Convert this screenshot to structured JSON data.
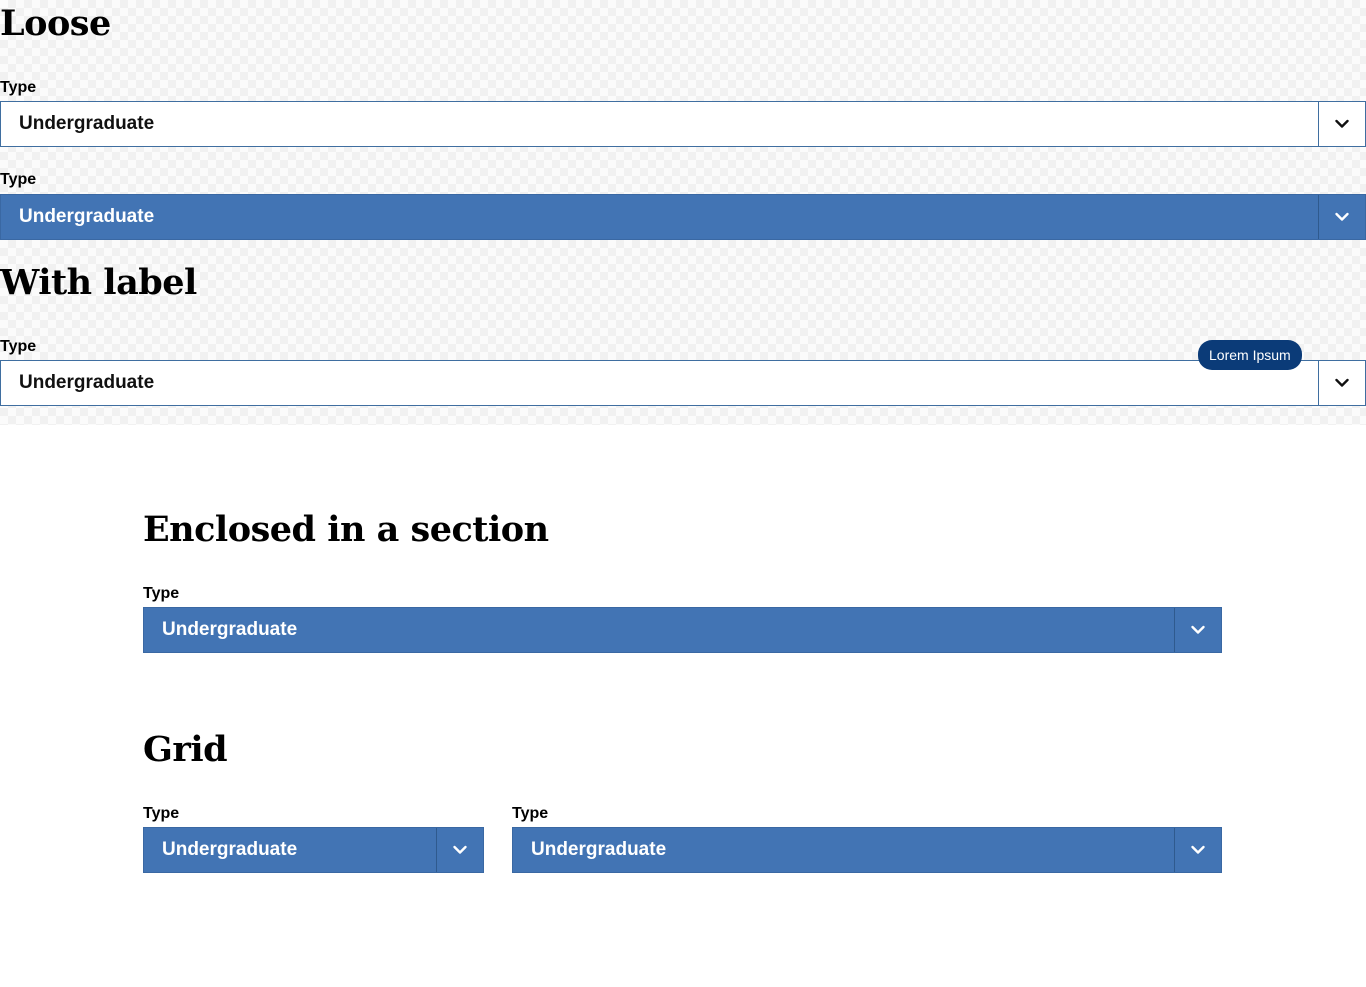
{
  "sections": {
    "loose": {
      "heading": "Loose",
      "fields": [
        {
          "label": "Type",
          "value": "Undergraduate",
          "variant": "light"
        },
        {
          "label": "Type",
          "value": "Undergraduate",
          "variant": "solid"
        }
      ]
    },
    "with_label": {
      "heading": "With label",
      "field": {
        "label": "Type",
        "value": "Undergraduate",
        "badge": "Lorem Ipsum"
      }
    },
    "enclosed": {
      "heading": "Enclosed in a section",
      "field": {
        "label": "Type",
        "value": "Undergraduate"
      }
    },
    "grid": {
      "heading": "Grid",
      "fields": [
        {
          "label": "Type",
          "value": "Undergraduate"
        },
        {
          "label": "Type",
          "value": "Undergraduate"
        }
      ]
    }
  },
  "colors": {
    "accent": "#4274b4",
    "badge": "#0b3b78",
    "border": "#3f6ea0"
  },
  "icons": {
    "dropdown": "chevron-down-icon"
  }
}
